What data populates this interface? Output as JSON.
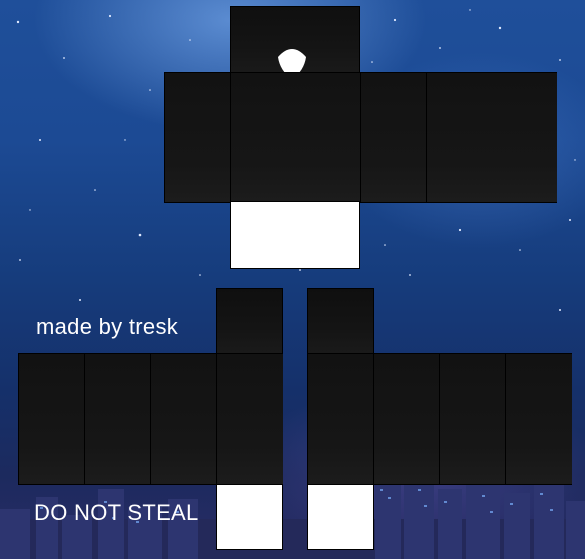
{
  "credit_text": "made by tresk",
  "warning_text": "DO NOT STEAL",
  "colors": {
    "shirt": "#131313",
    "pants_white": "#ffffff",
    "sky_top": "#1f4f9a",
    "sky_bottom": "#2a2c66"
  },
  "icons": {
    "hood": "hood-opening-icon"
  }
}
